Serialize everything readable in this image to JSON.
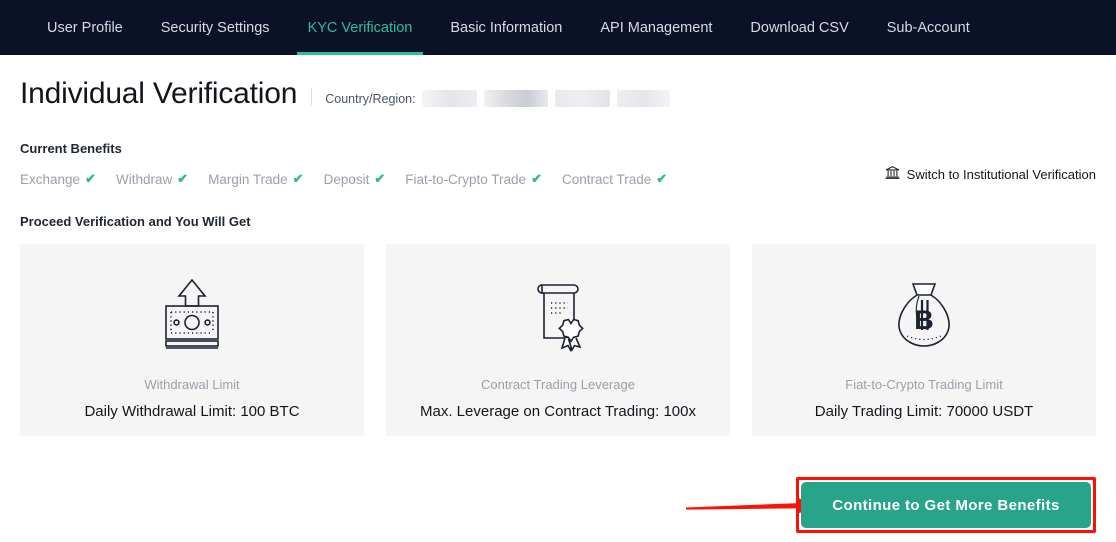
{
  "nav": {
    "items": [
      {
        "label": "User Profile",
        "active": false
      },
      {
        "label": "Security Settings",
        "active": false
      },
      {
        "label": "KYC Verification",
        "active": true
      },
      {
        "label": "Basic Information",
        "active": false
      },
      {
        "label": "API Management",
        "active": false
      },
      {
        "label": "Download CSV",
        "active": false
      },
      {
        "label": "Sub-Account",
        "active": false
      }
    ],
    "background_color": "#0b1126",
    "active_color": "#2ebd9c"
  },
  "header": {
    "title": "Individual Verification",
    "country_label": "Country/Region:",
    "country_value_redacted": true,
    "switch_link": "Switch to Institutional Verification",
    "switch_icon": "bank-icon"
  },
  "current_benefits": {
    "heading": "Current Benefits",
    "items": [
      {
        "label": "Exchange",
        "check": "✔"
      },
      {
        "label": "Withdraw",
        "check": "✔"
      },
      {
        "label": "Margin Trade",
        "check": "✔"
      },
      {
        "label": "Deposit",
        "check": "✔"
      },
      {
        "label": "Fiat-to-Crypto Trade",
        "check": "✔"
      },
      {
        "label": "Contract Trade",
        "check": "✔"
      }
    ],
    "check_color": "#2ebd85"
  },
  "proceed": {
    "heading": "Proceed Verification and You Will Get",
    "cards": [
      {
        "icon": "banknote-upload-icon",
        "subtitle": "Withdrawal Limit",
        "value": "Daily Withdrawal Limit: 100 BTC"
      },
      {
        "icon": "certificate-seal-icon",
        "subtitle": "Contract Trading Leverage",
        "value": "Max. Leverage on Contract Trading: 100x"
      },
      {
        "icon": "money-bag-bitcoin-icon",
        "subtitle": "Fiat-to-Crypto Trading Limit",
        "value": "Daily Trading Limit: 70000 USDT"
      }
    ]
  },
  "action": {
    "cta_label": "Continue to Get More Benefits",
    "cta_color": "#27a489",
    "annotation_color": "#fb1105",
    "annotation_arrow": "red-arrow-pointing-right"
  }
}
